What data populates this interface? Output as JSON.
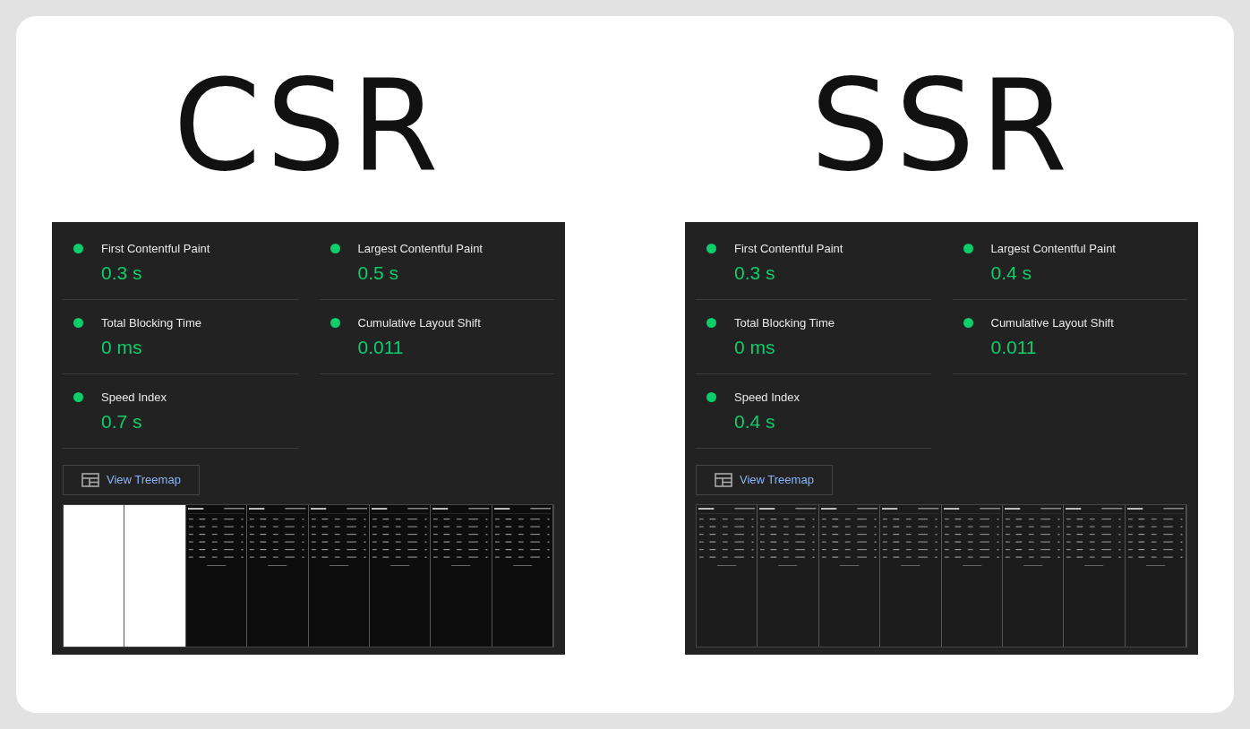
{
  "panels": [
    {
      "title": "CSR",
      "metrics": [
        {
          "label": "First Contentful Paint",
          "value": "0.3 s",
          "color": "#0cce6b"
        },
        {
          "label": "Largest Contentful Paint",
          "value": "0.5 s",
          "color": "#0cce6b"
        },
        {
          "label": "Total Blocking Time",
          "value": "0 ms",
          "color": "#0cce6b"
        },
        {
          "label": "Cumulative Layout Shift",
          "value": "0.011",
          "color": "#0cce6b"
        },
        {
          "label": "Speed Index",
          "value": "0.7 s",
          "color": "#0cce6b"
        }
      ],
      "treemap_button": "View Treemap",
      "filmstrip": [
        {
          "kind": "blank"
        },
        {
          "kind": "blank"
        },
        {
          "kind": "app"
        },
        {
          "kind": "app"
        },
        {
          "kind": "app"
        },
        {
          "kind": "app"
        },
        {
          "kind": "app"
        },
        {
          "kind": "app"
        }
      ]
    },
    {
      "title": "SSR",
      "metrics": [
        {
          "label": "First Contentful Paint",
          "value": "0.3 s",
          "color": "#0cce6b"
        },
        {
          "label": "Largest Contentful Paint",
          "value": "0.4 s",
          "color": "#0cce6b"
        },
        {
          "label": "Total Blocking Time",
          "value": "0 ms",
          "color": "#0cce6b"
        },
        {
          "label": "Cumulative Layout Shift",
          "value": "0.011",
          "color": "#0cce6b"
        },
        {
          "label": "Speed Index",
          "value": "0.4 s",
          "color": "#0cce6b"
        }
      ],
      "treemap_button": "View Treemap",
      "filmstrip": [
        {
          "kind": "app"
        },
        {
          "kind": "app"
        },
        {
          "kind": "app"
        },
        {
          "kind": "app"
        },
        {
          "kind": "app"
        },
        {
          "kind": "app"
        },
        {
          "kind": "app"
        },
        {
          "kind": "app"
        }
      ]
    }
  ]
}
